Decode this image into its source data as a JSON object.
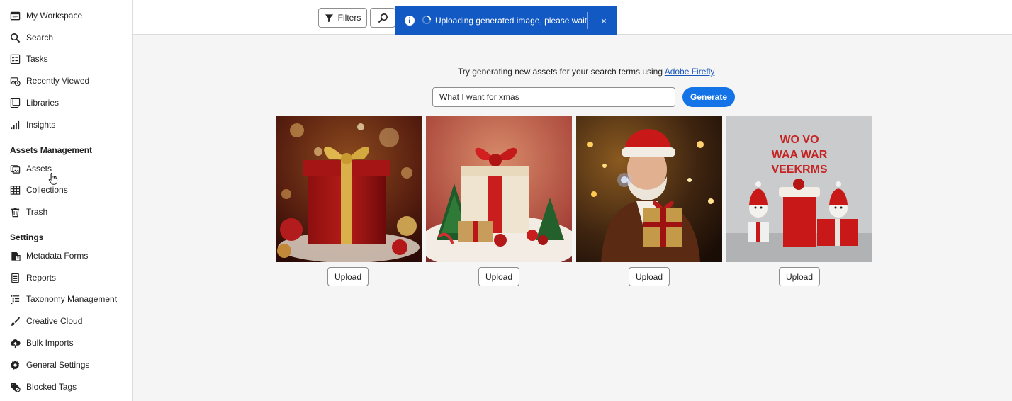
{
  "sidebar": {
    "items_top": [
      {
        "label": "My Workspace",
        "icon": "workspace-icon"
      },
      {
        "label": "Search",
        "icon": "search-icon"
      },
      {
        "label": "Tasks",
        "icon": "tasks-icon"
      },
      {
        "label": "Recently Viewed",
        "icon": "recently-viewed-icon"
      },
      {
        "label": "Libraries",
        "icon": "libraries-icon"
      },
      {
        "label": "Insights",
        "icon": "insights-icon"
      }
    ],
    "assets_section_title": "Assets Management",
    "items_assets": [
      {
        "label": "Assets",
        "icon": "assets-icon"
      },
      {
        "label": "Collections",
        "icon": "collections-icon"
      },
      {
        "label": "Trash",
        "icon": "trash-icon"
      }
    ],
    "settings_section_title": "Settings",
    "items_settings": [
      {
        "label": "Metadata Forms",
        "icon": "metadata-forms-icon"
      },
      {
        "label": "Reports",
        "icon": "reports-icon"
      },
      {
        "label": "Taxonomy Management",
        "icon": "taxonomy-icon"
      },
      {
        "label": "Creative Cloud",
        "icon": "creative-cloud-icon"
      },
      {
        "label": "Bulk Imports",
        "icon": "bulk-imports-icon"
      },
      {
        "label": "General Settings",
        "icon": "gear-icon"
      },
      {
        "label": "Blocked Tags",
        "icon": "blocked-tags-icon"
      }
    ]
  },
  "toolbar": {
    "filters_label": "Filters"
  },
  "toast": {
    "message": "Uploading generated image, please wait",
    "close_label": "×",
    "color": "#1259c3"
  },
  "main": {
    "prompt_text": "Try generating new assets for your search terms using ",
    "prompt_link": "Adobe Firefly",
    "input_value": "What I want for xmas",
    "generate_label": "Generate",
    "generate_color": "#1473e6",
    "images": [
      {
        "upload_label": "Upload"
      },
      {
        "upload_label": "Upload"
      },
      {
        "upload_label": "Upload"
      },
      {
        "upload_label": "Upload",
        "image_text": [
          "WO VO",
          "WAA WAR",
          "VEEKRMS"
        ]
      }
    ]
  }
}
